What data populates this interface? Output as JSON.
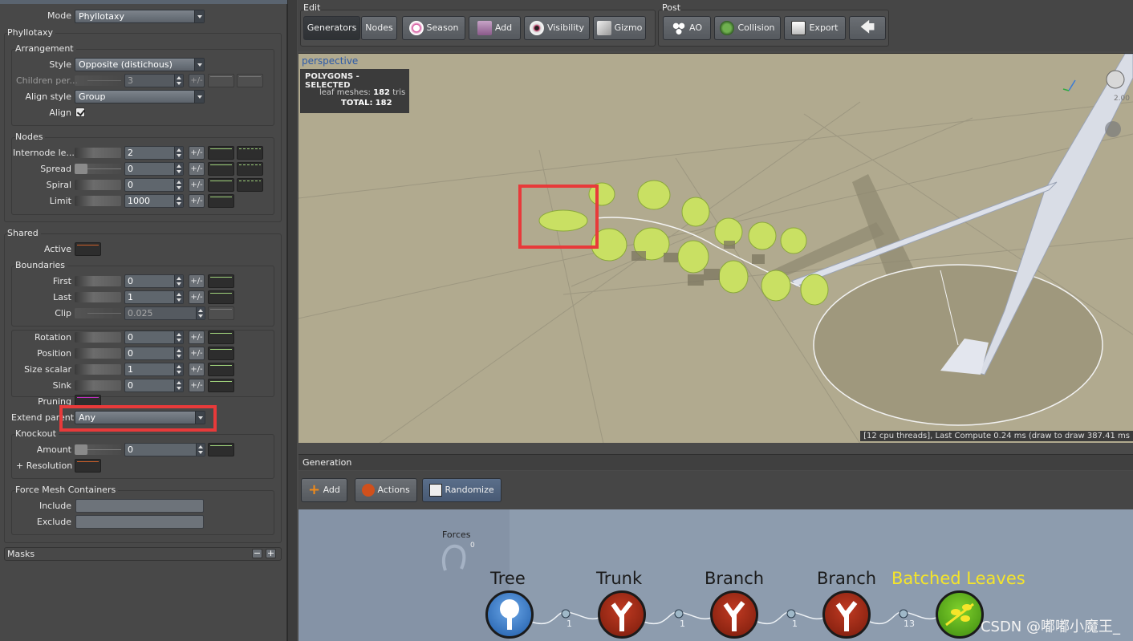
{
  "left_panel": {
    "mode_label": "Mode",
    "mode_value": "Phyllotaxy",
    "phyllotaxy_title": "Phyllotaxy",
    "arrangement_title": "Arrangement",
    "style_label": "Style",
    "style_value": "Opposite (distichous)",
    "children_label": "Children per...",
    "children_value": "3",
    "align_style_label": "Align style",
    "align_style_value": "Group",
    "align_label": "Align",
    "nodes_title": "Nodes",
    "internode_label": "Internode le...",
    "internode_value": "2",
    "spread_label": "Spread",
    "spread_value": "0",
    "spiral_label": "Spiral",
    "spiral_value": "0",
    "limit_label": "Limit",
    "limit_value": "1000",
    "shared_title": "Shared",
    "active_label": "Active",
    "boundaries_title": "Boundaries",
    "first_label": "First",
    "first_value": "0",
    "last_label": "Last",
    "last_value": "1",
    "clip_label": "Clip",
    "clip_value": "0.025",
    "rotation_label": "Rotation",
    "rotation_value": "0",
    "position_label": "Position",
    "position_value": "0",
    "size_scalar_label": "Size scalar",
    "size_scalar_value": "1",
    "sink_label": "Sink",
    "sink_value": "0",
    "pruning_label": "Pruning",
    "extend_parent_label": "Extend parent",
    "extend_parent_value": "Any",
    "knockout_title": "Knockout",
    "amount_label": "Amount",
    "amount_value": "0",
    "resolution_label": "+ Resolution",
    "force_mesh_title": "Force Mesh Containers",
    "include_label": "Include",
    "exclude_label": "Exclude",
    "masks_label": "Masks",
    "pm_label": "+/-",
    "masks_minus": "−",
    "masks_plus": "+"
  },
  "toolbar": {
    "edit_label": "Edit",
    "post_label": "Post",
    "generators": "Generators",
    "nodes": "Nodes",
    "season": "Season",
    "add": "Add",
    "visibility": "Visibility",
    "gizmo": "Gizmo",
    "ao": "AO",
    "collision": "Collision",
    "export": "Export"
  },
  "viewport": {
    "view_name": "perspective",
    "poly_title": "POLYGONS - SELECTED",
    "leaf_meshes_label": "leaf meshes:",
    "leaf_meshes_value": "182",
    "tris": "tris",
    "total_label": "TOTAL:",
    "total_value": "182",
    "axis_value": "2.00",
    "status": "[12 cpu threads], Last Compute 0.24 ms (draw to draw 387.41 ms"
  },
  "generation": {
    "title": "Generation",
    "add": "Add",
    "actions": "Actions",
    "randomize": "Randomize",
    "forces_label": "Forces",
    "forces_count": "0",
    "nodes": [
      "Tree",
      "Trunk",
      "Branch",
      "Branch",
      "Batched Leaves"
    ],
    "connections": [
      "1",
      "1",
      "1",
      "13"
    ]
  },
  "watermark": "CSDN @嘟嘟小魔王_",
  "colors": {
    "highlight_box": "#e83a3a",
    "viewport_bg": "#b1aa8f",
    "leaf_node_label": "#f5e52a",
    "perspective_label": "#2c5aa8"
  }
}
